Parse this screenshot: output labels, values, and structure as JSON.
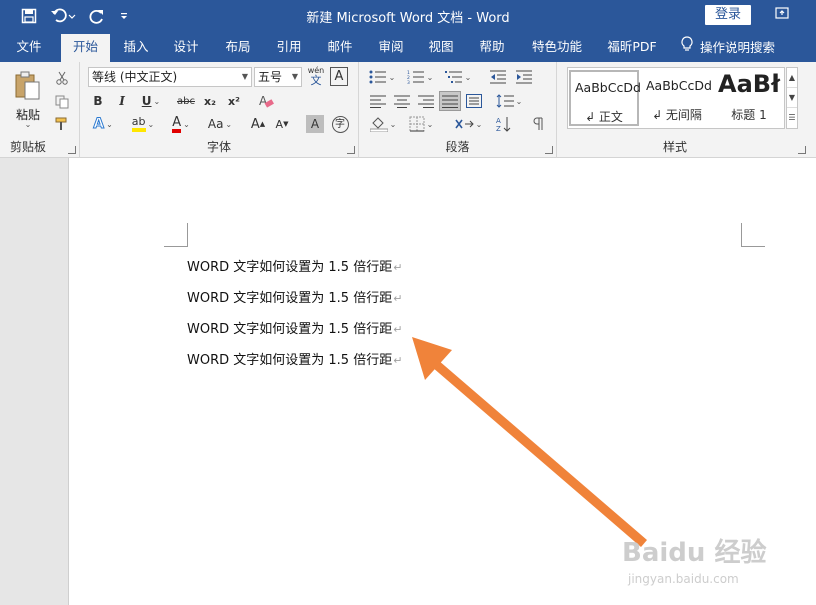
{
  "titlebar": {
    "title": "新建 Microsoft Word 文档  -  Word",
    "login": "登录",
    "colors": {
      "bar": "#2b579a"
    }
  },
  "qat": {
    "icons": [
      "save-icon",
      "undo-icon",
      "redo-icon",
      "customize-icon"
    ]
  },
  "tabs": [
    {
      "label": "文件"
    },
    {
      "label": "开始"
    },
    {
      "label": "插入"
    },
    {
      "label": "设计"
    },
    {
      "label": "布局"
    },
    {
      "label": "引用"
    },
    {
      "label": "邮件"
    },
    {
      "label": "审阅"
    },
    {
      "label": "视图"
    },
    {
      "label": "帮助"
    },
    {
      "label": "特色功能"
    },
    {
      "label": "福昕PDF"
    }
  ],
  "active_tab": "开始",
  "tellme": "操作说明搜索",
  "ribbon": {
    "clipboard": {
      "label": "剪贴板",
      "paste": "粘贴"
    },
    "font": {
      "label": "字体",
      "font_name": "等线 (中文正文)",
      "font_size": "五号",
      "phonetic_top": "wén",
      "phonetic_char": "文",
      "border_char": "A",
      "bold": "B",
      "italic": "I",
      "underline": "U",
      "strike": "abc",
      "sub": "x₂",
      "sup": "x²",
      "effects": "A",
      "highlight": "ab",
      "color": "A",
      "case": "Aa",
      "grow": "A",
      "shrink": "A",
      "shade": "A",
      "circle": "字"
    },
    "paragraph": {
      "label": "段落"
    },
    "styles": {
      "label": "样式",
      "items": [
        {
          "sample": "AaBbCcDd",
          "name": "↲ 正文"
        },
        {
          "sample": "AaBbCcDd",
          "name": "↲ 无间隔"
        },
        {
          "sample": "AaBł",
          "name": "标题 1"
        }
      ]
    }
  },
  "document": {
    "paragraphs": [
      "WORD 文字如何设置为 1.5 倍行距",
      "WORD 文字如何设置为 1.5 倍行距",
      "WORD 文字如何设置为 1.5 倍行距",
      "WORD 文字如何设置为 1.5 倍行距"
    ],
    "paragraph_mark": "↵"
  },
  "annotation": {
    "arrow_color": "#f0833a"
  },
  "watermark": {
    "main": "Baidu 经验",
    "sub": "jingyan.baidu.com"
  }
}
